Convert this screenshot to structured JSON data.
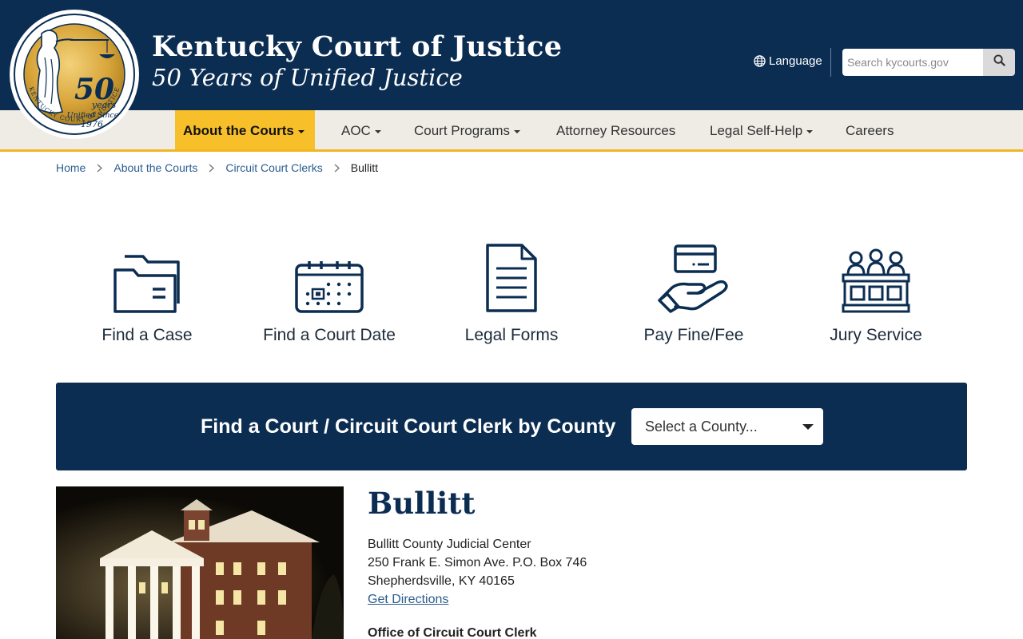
{
  "header": {
    "title": "Kentucky Court of Justice",
    "subtitle": "50 Years of Unified Justice",
    "seal": {
      "years_number": "50",
      "years_word": "years",
      "unified_since": "Unified Since",
      "since_year": "1976",
      "ring_text": "KENTUCKY COURT OF JUSTICE"
    },
    "language_label": "Language",
    "search_placeholder": "Search kycourts.gov"
  },
  "nav": {
    "items": [
      {
        "label": "About the Courts",
        "active": true,
        "dropdown": true
      },
      {
        "label": "AOC",
        "dropdown": true
      },
      {
        "label": "Court Programs",
        "dropdown": true
      },
      {
        "label": "Attorney Resources",
        "dropdown": false
      },
      {
        "label": "Legal Self-Help",
        "dropdown": true
      },
      {
        "label": "Careers",
        "dropdown": false
      }
    ]
  },
  "breadcrumb": {
    "items": [
      "Home",
      "About the Courts",
      "Circuit Court Clerks"
    ],
    "current": "Bullitt"
  },
  "quick_links": [
    {
      "label": "Find a Case",
      "icon": "folder-icon"
    },
    {
      "label": "Find a Court Date",
      "icon": "calendar-icon"
    },
    {
      "label": "Legal Forms",
      "icon": "document-icon"
    },
    {
      "label": "Pay Fine/Fee",
      "icon": "card-payment-icon"
    },
    {
      "label": "Jury Service",
      "icon": "jury-box-icon"
    }
  ],
  "county_finder": {
    "label": "Find a Court / Circuit Court Clerk by County",
    "select_value": "Select a County..."
  },
  "county": {
    "name": "Bullitt",
    "building": "Bullitt County Judicial Center",
    "street": "250 Frank E. Simon Ave. P.O. Box 746",
    "city": "Shepherdsville, KY 40165",
    "directions_label": "Get Directions",
    "office_title": "Office of Circuit Court Clerk"
  },
  "colors": {
    "navy": "#0b2d52",
    "gold": "#f7c02a",
    "nav_bg": "#efece6",
    "link": "#2a5d8f"
  }
}
